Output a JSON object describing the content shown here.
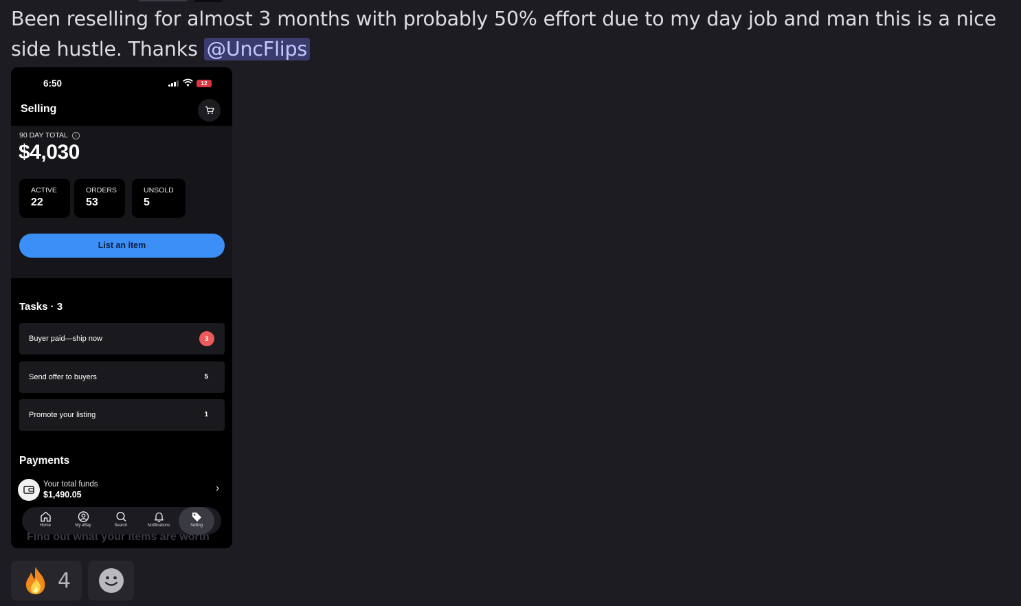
{
  "message": {
    "text": "Been reselling for almost 3 months with probably 50% effort due to my day job and man this is a nice side hustle. Thanks",
    "mention": "@UncFlips"
  },
  "phone": {
    "status": {
      "time": "6:50",
      "battery": "12"
    },
    "header": {
      "title": "Selling",
      "cart_icon": "cart-icon"
    },
    "summary": {
      "label": "90 DAY TOTAL",
      "amount": "$4,030",
      "stats": [
        {
          "label": "ACTIVE",
          "value": "22"
        },
        {
          "label": "ORDERS",
          "value": "53"
        },
        {
          "label": "UNSOLD",
          "value": "5"
        }
      ],
      "cta": "List an item"
    },
    "tasks": {
      "title": "Tasks · 3",
      "items": [
        {
          "label": "Buyer paid—ship now",
          "count": "3"
        },
        {
          "label": "Send offer to buyers",
          "count": "5"
        },
        {
          "label": "Promote your listing",
          "count": "1"
        }
      ]
    },
    "payments": {
      "title": "Payments",
      "funds_label": "Your total funds",
      "funds_value": "$1,490.05"
    },
    "promo": "Find out what your items are worth",
    "tabs": [
      {
        "label": "Home",
        "icon": "home-icon"
      },
      {
        "label": "My eBay",
        "icon": "user-circle-icon"
      },
      {
        "label": "Search",
        "icon": "search-icon"
      },
      {
        "label": "Notifications",
        "icon": "bell-icon"
      },
      {
        "label": "Selling",
        "icon": "tag-icon",
        "active": true
      }
    ]
  },
  "reactions": {
    "fire": {
      "emoji": "fire-emoji",
      "count": "4"
    },
    "add": {
      "icon": "smiley-icon"
    }
  }
}
